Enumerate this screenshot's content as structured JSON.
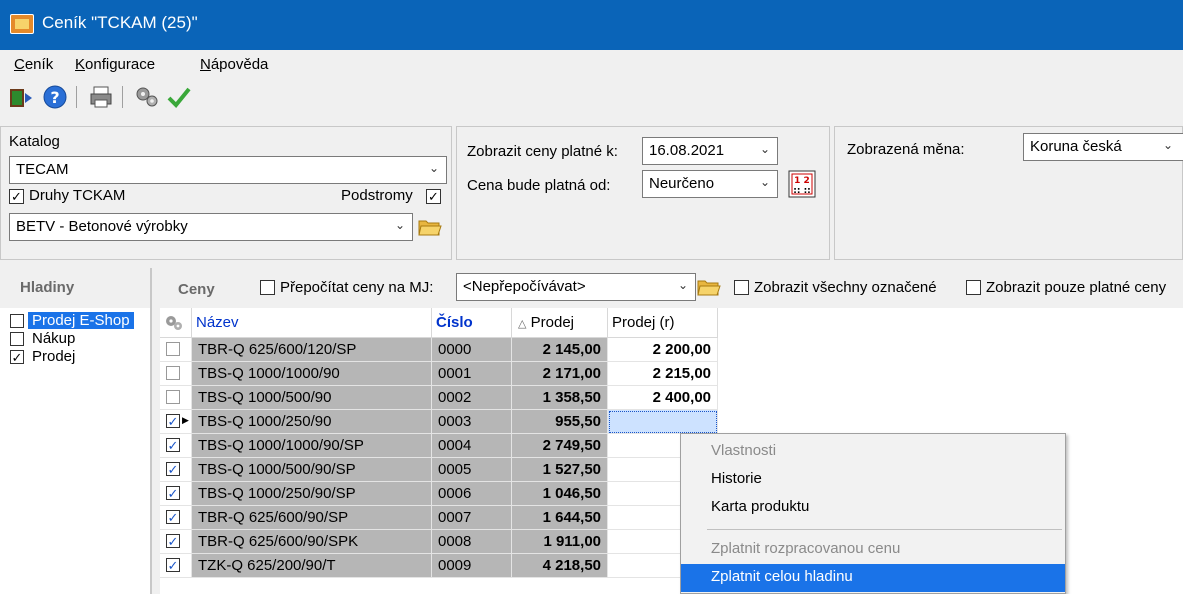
{
  "window": {
    "title": "Ceník \"TCKAM (25)\""
  },
  "menu": [
    {
      "accel": "C",
      "rest": "eník"
    },
    {
      "accel": "K",
      "rest": "onfigurace"
    },
    {
      "accel": "N",
      "rest": "ápověda"
    }
  ],
  "catalog": {
    "label": "Katalog",
    "value": "TECAM",
    "druhy_label": "Druhy TCKAM",
    "podstromy_label": "Podstromy",
    "category_value": "BETV - Betonové výrobky"
  },
  "dates": {
    "show_label": "Zobrazit ceny platné k:",
    "show_value": "16.08.2021",
    "valid_from_label": "Cena bude platná od:",
    "valid_from_value": "Neurčeno"
  },
  "currency": {
    "label": "Zobrazená měna:",
    "value": "Koruna česká"
  },
  "levels": {
    "header": "Hladiny",
    "items": [
      {
        "label": "Prodej E-Shop",
        "checked": false,
        "selected": true
      },
      {
        "label": "Nákup",
        "checked": false,
        "selected": false
      },
      {
        "label": "Prodej",
        "checked": true,
        "selected": false
      }
    ]
  },
  "prices_toolbar": {
    "header": "Ceny",
    "recalc_label": "Přepočítat ceny na MJ:",
    "recalc_value": "<Nepřepočívávat>",
    "show_all_marked": "Zobrazit všechny označené",
    "show_only_valid": "Zobrazit pouze platné ceny"
  },
  "table": {
    "columns": {
      "name": "Název",
      "number": "Číslo",
      "sale": "Prodej",
      "sale_r": "Prodej (r)"
    },
    "rows": [
      {
        "checked": false,
        "name": "TBR-Q 625/600/120/SP",
        "number": "0000",
        "sale": "2 145,00",
        "sale_r": "2 200,00"
      },
      {
        "checked": false,
        "name": "TBS-Q 1000/1000/90",
        "number": "0001",
        "sale": "2 171,00",
        "sale_r": "2 215,00"
      },
      {
        "checked": false,
        "name": "TBS-Q 1000/500/90",
        "number": "0002",
        "sale": "1 358,50",
        "sale_r": "2 400,00"
      },
      {
        "checked": true,
        "name": "TBS-Q 1000/250/90",
        "number": "0003",
        "sale": "955,50",
        "sale_r": ""
      },
      {
        "checked": true,
        "name": "TBS-Q 1000/1000/90/SP",
        "number": "0004",
        "sale": "2 749,50",
        "sale_r": ""
      },
      {
        "checked": true,
        "name": "TBS-Q 1000/500/90/SP",
        "number": "0005",
        "sale": "1 527,50",
        "sale_r": ""
      },
      {
        "checked": true,
        "name": "TBS-Q 1000/250/90/SP",
        "number": "0006",
        "sale": "1 046,50",
        "sale_r": ""
      },
      {
        "checked": true,
        "name": "TBR-Q 625/600/90/SP",
        "number": "0007",
        "sale": "1 644,50",
        "sale_r": ""
      },
      {
        "checked": true,
        "name": "TBR-Q 625/600/90/SPK",
        "number": "0008",
        "sale": "1 911,00",
        "sale_r": ""
      },
      {
        "checked": true,
        "name": "TZK-Q 625/200/90/T",
        "number": "0009",
        "sale": "4 218,50",
        "sale_r": ""
      }
    ]
  },
  "context_menu": {
    "items": [
      {
        "label": "Vlastnosti",
        "disabled": true
      },
      {
        "label": "Historie",
        "disabled": false
      },
      {
        "label": "Karta produktu",
        "disabled": false
      },
      {
        "label": "Zplatnit rozpracovanou cenu",
        "disabled": true
      },
      {
        "label": "Zplatnit celou hladinu",
        "disabled": false,
        "highlighted": true
      }
    ]
  },
  "colors": {
    "titlebar": "#0a64b8",
    "grid_gray": "#b6b6b6",
    "highlight": "#1a73e8",
    "link_blue": "#0033cc"
  }
}
